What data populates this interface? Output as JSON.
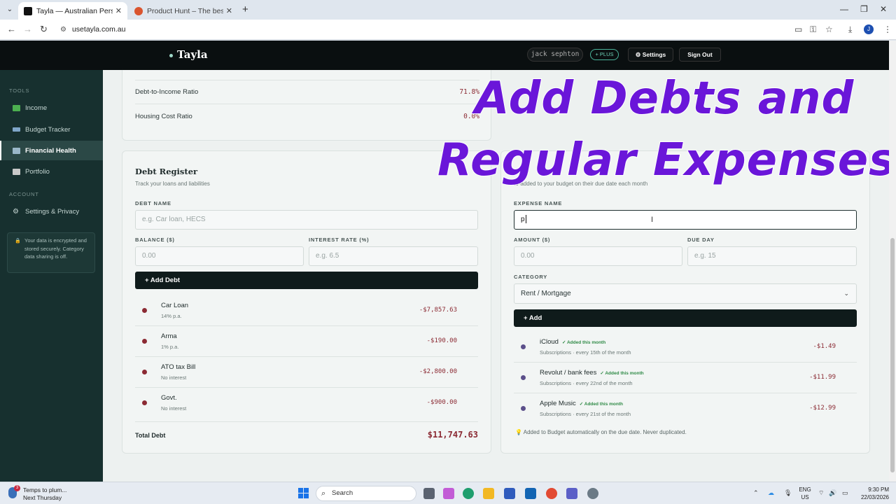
{
  "browser": {
    "tabs": [
      {
        "title": "Tayla — Australian Personal Fin",
        "active": true,
        "favicon_color": "#111111"
      },
      {
        "title": "Product Hunt – The best new p",
        "active": false,
        "favicon_color": "#da552f"
      }
    ],
    "url": "usetayla.com.au",
    "profile_initial": "J"
  },
  "header": {
    "brand": "Tayla",
    "user": "jack sephton",
    "plan": "+ PLUS",
    "settings": "⚙ Settings",
    "signout": "Sign Out"
  },
  "sidebar": {
    "tools_label": "TOOLS",
    "tools": [
      {
        "label": "Income",
        "icon": "income-icon",
        "color": "#4caf50"
      },
      {
        "label": "Budget Tracker",
        "icon": "budget-icon",
        "color": "#7fa6c9"
      },
      {
        "label": "Financial Health",
        "icon": "health-icon",
        "color": "#9ab7c8",
        "active": true
      },
      {
        "label": "Portfolio",
        "icon": "portfolio-icon",
        "color": "#c8c8c8"
      }
    ],
    "account_label": "ACCOUNT",
    "account": [
      {
        "label": "Settings & Privacy",
        "icon": "gear-icon"
      }
    ],
    "note": "Your data is encrypted and stored securely. Category data sharing is off."
  },
  "ratios": [
    {
      "label": "Debt-to-Income Ratio",
      "value": "71.8%"
    },
    {
      "label": "Housing Cost Ratio",
      "value": "0.0%"
    }
  ],
  "debt_register": {
    "title": "Debt Register",
    "subtitle": "Track your loans and liabilities",
    "name_label": "DEBT NAME",
    "name_placeholder": "e.g. Car loan, HECS",
    "balance_label": "BALANCE ($)",
    "balance_placeholder": "0.00",
    "rate_label": "INTEREST RATE (%)",
    "rate_placeholder": "e.g. 6.5",
    "add_button": "+ Add Debt",
    "items": [
      {
        "name": "Car Loan",
        "detail": "14% p.a.",
        "amount": "-$7,857.63"
      },
      {
        "name": "Arma",
        "detail": "1% p.a.",
        "amount": "-$190.00"
      },
      {
        "name": "ATO tax Bill",
        "detail": "No interest",
        "amount": "-$2,800.00"
      },
      {
        "name": "Govt.",
        "detail": "No interest",
        "amount": "-$900.00"
      }
    ],
    "total_label": "Total Debt",
    "total_value": "$11,747.63"
  },
  "expenses": {
    "subtitle": "to-added to your budget on their due date each month",
    "name_label": "EXPENSE NAME",
    "name_value": "p",
    "amount_label": "AMOUNT ($)",
    "amount_placeholder": "0.00",
    "due_label": "DUE DAY",
    "due_placeholder": "e.g. 15",
    "category_label": "CATEGORY",
    "category_value": "Rent / Mortgage",
    "add_button": "+ Add",
    "items": [
      {
        "name": "iCloud",
        "badge": "✓ Added this month",
        "detail": "Subscriptions · every 15th of the month",
        "amount": "-$1.49"
      },
      {
        "name": "Revolut / bank fees",
        "badge": "✓ Added this month",
        "detail": "Subscriptions · every 22nd of the month",
        "amount": "-$11.99"
      },
      {
        "name": "Apple Music",
        "badge": "✓ Added this month",
        "detail": "Subscriptions · every 21st of the month",
        "amount": "-$12.99"
      }
    ],
    "footnote": "💡 Added to Budget automatically on the due date. Never duplicated."
  },
  "overlay": {
    "line1": "Add Debts and",
    "line2": "Regular Expenses"
  },
  "taskbar": {
    "weather_line1": "Temps to plum...",
    "weather_line2": "Next Thursday",
    "weather_badge": "3",
    "search": "Search",
    "lang_line1": "ENG",
    "lang_line2": "US",
    "time": "9:30 PM",
    "date": "22/03/2026"
  },
  "colors": {
    "accent_purple": "#6a16d9",
    "negative_red": "#8b2a33",
    "sidebar_bg": "#17302f"
  }
}
